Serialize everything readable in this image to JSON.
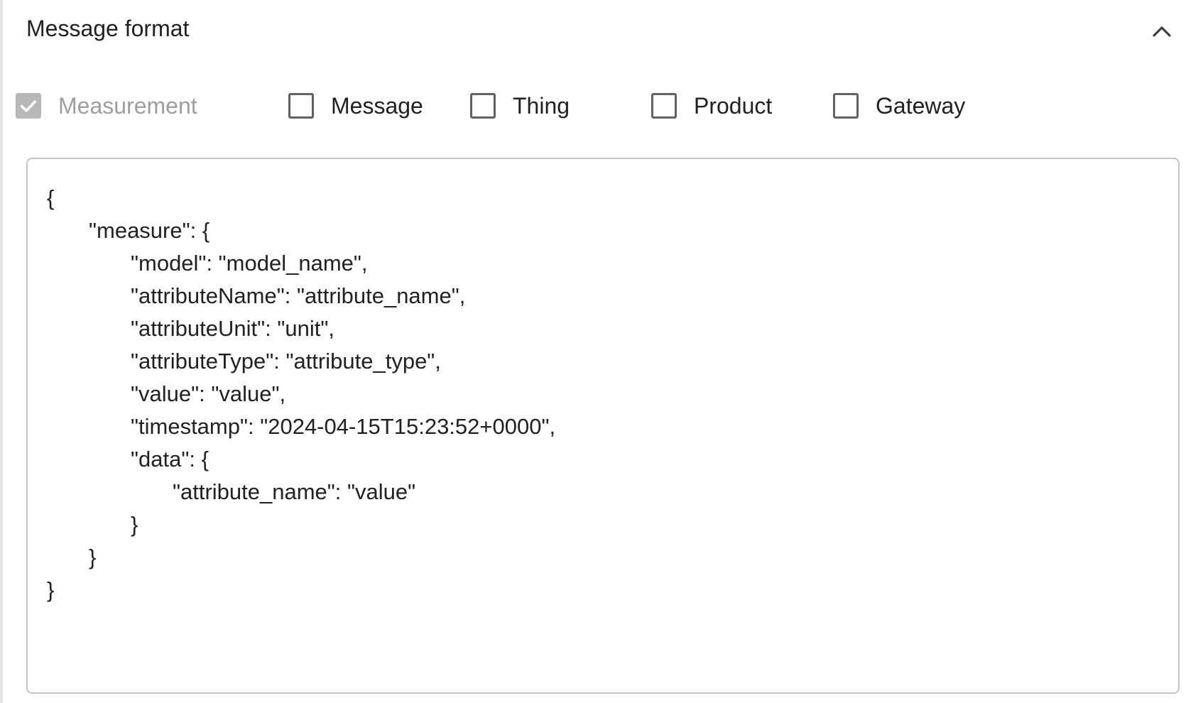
{
  "header": {
    "title": "Message format",
    "collapse_icon": "chevron-up-icon"
  },
  "options": [
    {
      "label": "Measurement",
      "checked": true,
      "disabled": true
    },
    {
      "label": "Message",
      "checked": false,
      "disabled": false
    },
    {
      "label": "Thing",
      "checked": false,
      "disabled": false
    },
    {
      "label": "Product",
      "checked": false,
      "disabled": false
    },
    {
      "label": "Gateway",
      "checked": false,
      "disabled": false
    }
  ],
  "code": {
    "lines": [
      {
        "indent": 0,
        "text": "{"
      },
      {
        "indent": 1,
        "text": "\"measure\": {"
      },
      {
        "indent": 2,
        "text": "\"model\": \"model_name\","
      },
      {
        "indent": 2,
        "text": "\"attributeName\": \"attribute_name\","
      },
      {
        "indent": 2,
        "text": "\"attributeUnit\": \"unit\","
      },
      {
        "indent": 2,
        "text": "\"attributeType\": \"attribute_type\","
      },
      {
        "indent": 2,
        "text": "\"value\": \"value\","
      },
      {
        "indent": 2,
        "text": "\"timestamp\": \"2024-04-15T15:23:52+0000\","
      },
      {
        "indent": 2,
        "text": "\"data\": {"
      },
      {
        "indent": 3,
        "text": "\"attribute_name\": \"value\""
      },
      {
        "indent": 2,
        "text": "}"
      },
      {
        "indent": 1,
        "text": "}"
      },
      {
        "indent": 0,
        "text": "}"
      }
    ]
  },
  "colors": {
    "checkbox_border": "#5f6368",
    "checkbox_disabled": "#b8b8b8",
    "disabled_text": "#9e9e9e",
    "box_border": "#c4c4c4"
  }
}
